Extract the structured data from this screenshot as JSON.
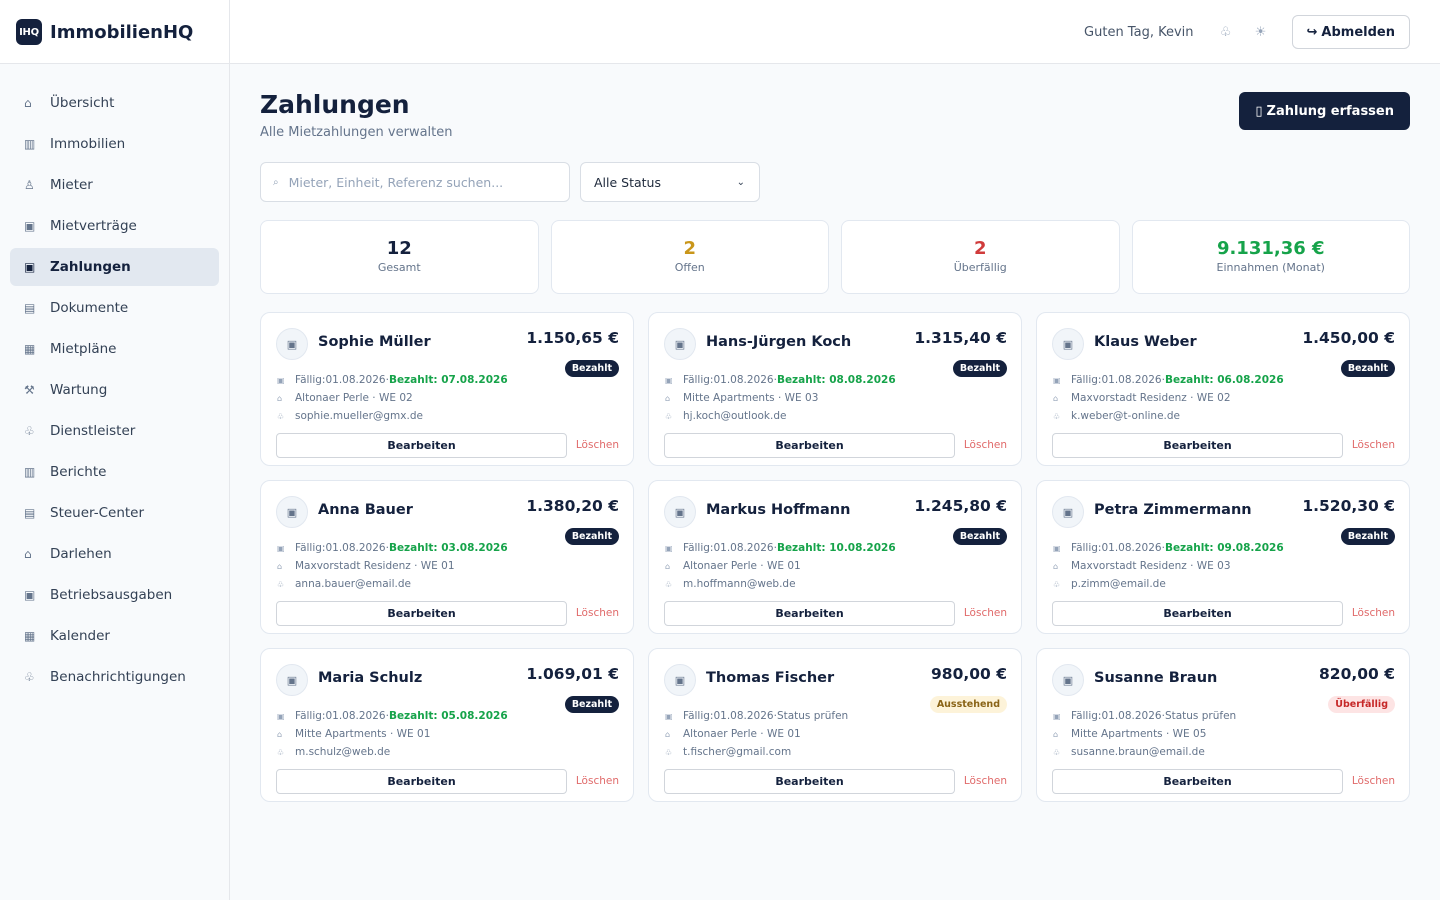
{
  "brand": {
    "logo": "IHQ",
    "name": "ImmobilienHQ"
  },
  "header": {
    "greeting": "Guten Tag, Kevin",
    "icons": [
      "user-icon",
      "theme-toggle-icon"
    ],
    "logout_icon": "↪",
    "logout_label": "Abmelden"
  },
  "sidebar": {
    "active": "Zahlungen",
    "items": [
      {
        "label": "Übersicht",
        "icon": "home-icon",
        "glyph": "⌂"
      },
      {
        "label": "Immobilien",
        "icon": "building-icon",
        "glyph": "▥"
      },
      {
        "label": "Mieter",
        "icon": "person-icon",
        "glyph": "♙"
      },
      {
        "label": "Mietverträge",
        "icon": "contract-icon",
        "glyph": "▣"
      },
      {
        "label": "Zahlungen",
        "icon": "payment-icon",
        "glyph": "▣"
      },
      {
        "label": "Dokumente",
        "icon": "document-icon",
        "glyph": "▤"
      },
      {
        "label": "Mietpläne",
        "icon": "plan-icon",
        "glyph": "▦"
      },
      {
        "label": "Wartung",
        "icon": "tools-icon",
        "glyph": "⚒"
      },
      {
        "label": "Dienstleister",
        "icon": "provider-icon",
        "glyph": "♧"
      },
      {
        "label": "Berichte",
        "icon": "report-icon",
        "glyph": "▥"
      },
      {
        "label": "Steuer-Center",
        "icon": "tax-icon",
        "glyph": "▤"
      },
      {
        "label": "Darlehen",
        "icon": "loan-icon",
        "glyph": "⌂"
      },
      {
        "label": "Betriebsausgaben",
        "icon": "expenses-icon",
        "glyph": "▣"
      },
      {
        "label": "Kalender",
        "icon": "calendar-icon",
        "glyph": "▦"
      },
      {
        "label": "Benachrichtigungen",
        "icon": "bell-icon",
        "glyph": "♧"
      }
    ]
  },
  "page": {
    "title": "Zahlungen",
    "subtitle": "Alle Mietzahlungen verwalten",
    "add_button_icon": "▯",
    "add_button": "Zahlung erfassen"
  },
  "search": {
    "placeholder": "Mieter, Einheit, Referenz suchen...",
    "value": ""
  },
  "status_filter": {
    "selected": "Alle Status"
  },
  "stats": [
    {
      "value": "12",
      "label": "Gesamt",
      "color": "#14213d"
    },
    {
      "value": "2",
      "label": "Offen",
      "color": "#c9961a"
    },
    {
      "value": "2",
      "label": "Überfällig",
      "color": "#d03b3b"
    },
    {
      "value": "9.131,36 €",
      "label": "Einnahmen (Monat)",
      "color": "#16a34a"
    }
  ],
  "card_labels": {
    "edit": "Bearbeiten",
    "delete": "Löschen",
    "due_prefix": "Fällig: ",
    "sep": " · "
  },
  "payments": [
    {
      "tenant": "Sophie Müller",
      "amount": "1.150,65 €",
      "status": "Bezahlt",
      "kind": "paid",
      "due": "01.08.2026",
      "payment_note": "Bezahlt: 07.08.2026",
      "unit": "Altonaer Perle · WE 02",
      "email": "sophie.mueller@gmx.de"
    },
    {
      "tenant": "Hans-Jürgen Koch",
      "amount": "1.315,40 €",
      "status": "Bezahlt",
      "kind": "paid",
      "due": "01.08.2026",
      "payment_note": "Bezahlt: 08.08.2026",
      "unit": "Mitte Apartments · WE 03",
      "email": "hj.koch@outlook.de"
    },
    {
      "tenant": "Klaus Weber",
      "amount": "1.450,00 €",
      "status": "Bezahlt",
      "kind": "paid",
      "due": "01.08.2026",
      "payment_note": "Bezahlt: 06.08.2026",
      "unit": "Maxvorstadt Residenz · WE 02",
      "email": "k.weber@t-online.de"
    },
    {
      "tenant": "Anna Bauer",
      "amount": "1.380,20 €",
      "status": "Bezahlt",
      "kind": "paid",
      "due": "01.08.2026",
      "payment_note": "Bezahlt: 03.08.2026",
      "unit": "Maxvorstadt Residenz · WE 01",
      "email": "anna.bauer@email.de"
    },
    {
      "tenant": "Markus Hoffmann",
      "amount": "1.245,80 €",
      "status": "Bezahlt",
      "kind": "paid",
      "due": "01.08.2026",
      "payment_note": "Bezahlt: 10.08.2026",
      "unit": "Altonaer Perle · WE 01",
      "email": "m.hoffmann@web.de"
    },
    {
      "tenant": "Petra Zimmermann",
      "amount": "1.520,30 €",
      "status": "Bezahlt",
      "kind": "paid",
      "due": "01.08.2026",
      "payment_note": "Bezahlt: 09.08.2026",
      "unit": "Maxvorstadt Residenz · WE 03",
      "email": "p.zimm@email.de"
    },
    {
      "tenant": "Maria Schulz",
      "amount": "1.069,01 €",
      "status": "Bezahlt",
      "kind": "paid",
      "due": "01.08.2026",
      "payment_note": "Bezahlt: 05.08.2026",
      "unit": "Mitte Apartments · WE 01",
      "email": "m.schulz@web.de"
    },
    {
      "tenant": "Thomas Fischer",
      "amount": "980,00 €",
      "status": "Ausstehend",
      "kind": "pending",
      "due": "01.08.2026",
      "payment_note": "Status prüfen",
      "unit": "Altonaer Perle · WE 01",
      "email": "t.fischer@gmail.com"
    },
    {
      "tenant": "Susanne Braun",
      "amount": "820,00 €",
      "status": "Überfällig",
      "kind": "overdue",
      "due": "01.08.2026",
      "payment_note": "Status prüfen",
      "unit": "Mitte Apartments · WE 05",
      "email": "susanne.braun@email.de"
    }
  ]
}
